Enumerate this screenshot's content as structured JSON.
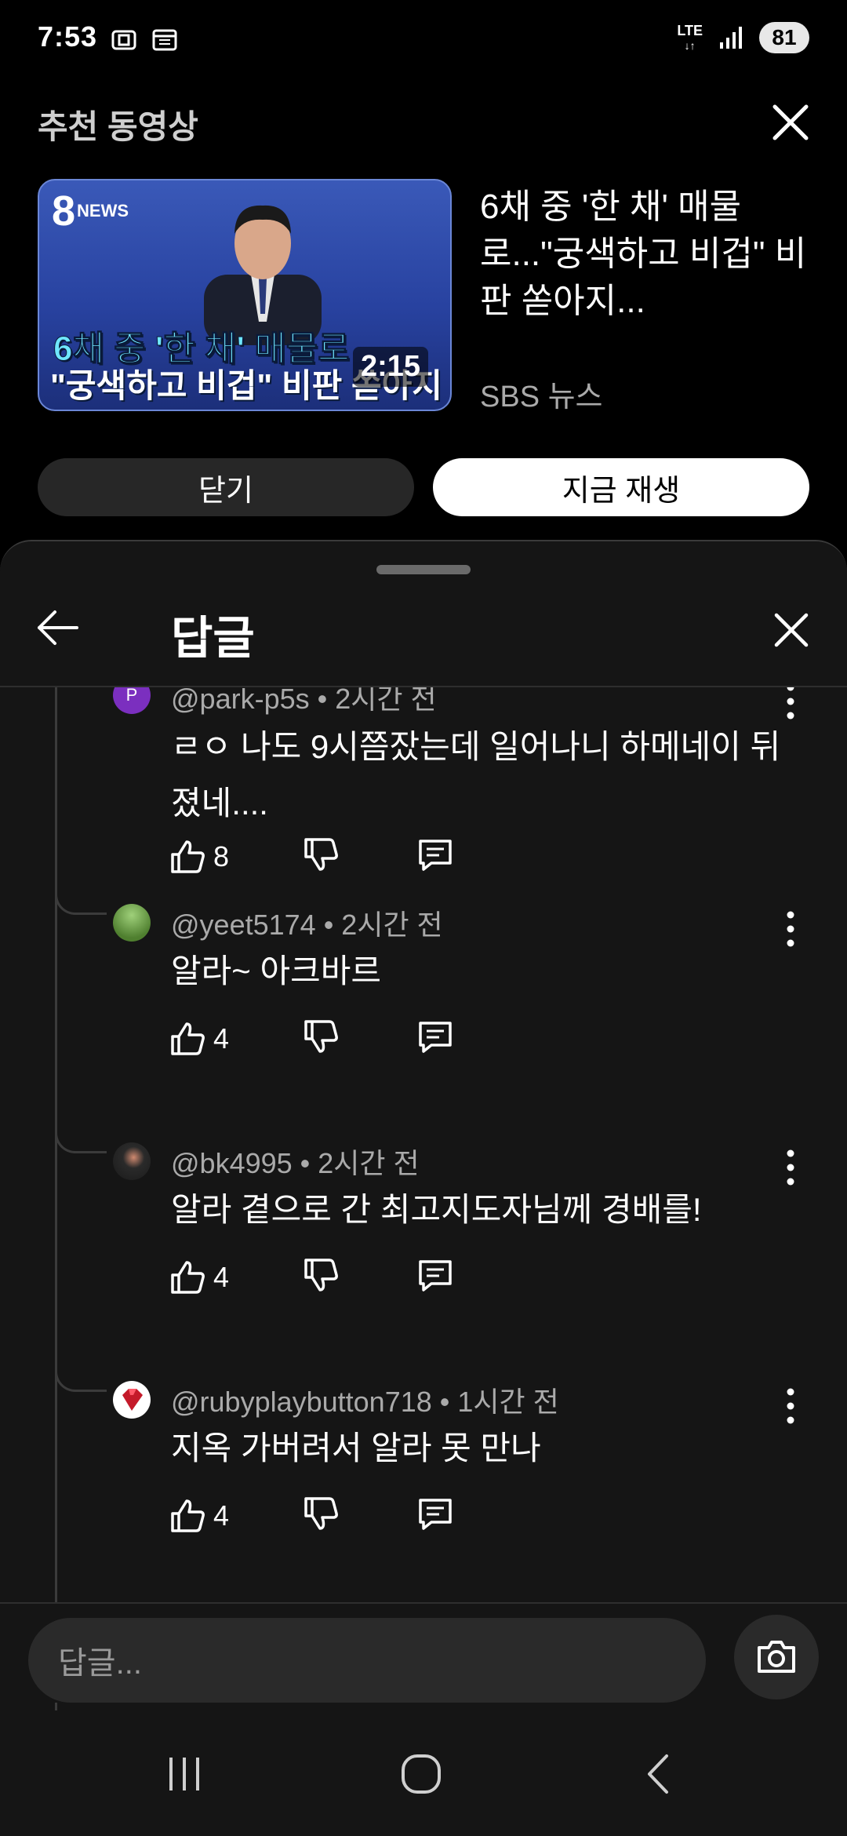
{
  "status_bar": {
    "time": "7:53",
    "network": "LTE",
    "battery": "81"
  },
  "recommended": {
    "header": "추천 동영상",
    "thumbnail": {
      "logo_number": "8",
      "logo_text": "NEWS",
      "caption_line1": "6채 중 '한 채' 매물로",
      "caption_line2": "\"궁색하고 비겁\" 비판 쏟아지",
      "duration": "2:15"
    },
    "video_title": "6채 중 '한 채' 매물로...\"궁색하고 비겁\" 비판 쏟아지...",
    "channel": "SBS 뉴스",
    "close_label": "닫기",
    "play_label": "지금 재생"
  },
  "sheet": {
    "title": "답글"
  },
  "replies": [
    {
      "author": "@park-p5s",
      "time": "2시간 전",
      "text": "ㄹㅇ 나도 9시쯤잤는데 일어나니 하메네이 뒤졌네....",
      "likes": "8",
      "avatar_letter": "P",
      "avatar_color": "#7b2fbf"
    },
    {
      "author": "@yeet5174",
      "time": "2시간 전",
      "text": "알라~ 아크바르",
      "likes": "4",
      "avatar_color": "#5a8a3a"
    },
    {
      "author": "@bk4995",
      "time": "2시간 전",
      "text": "알라 곁으로 간 최고지도자님께 경배를!",
      "likes": "4",
      "avatar_color": "#2a2a2a"
    },
    {
      "author": "@rubyplaybutton718",
      "time": "1시간 전",
      "text": "지옥 가버려서 알라 못 만나",
      "likes": "4",
      "avatar_color": "#c41a2a"
    }
  ],
  "reply_input": {
    "placeholder": "답글..."
  },
  "icons": {
    "close": "close-icon",
    "back": "arrow-left-icon",
    "like": "thumbs-up-icon",
    "dislike": "thumbs-down-icon",
    "reply": "comment-icon",
    "more": "more-vert-icon",
    "camera": "camera-icon",
    "nav_recents": "recents-icon",
    "nav_home": "home-icon",
    "nav_back": "back-icon"
  }
}
